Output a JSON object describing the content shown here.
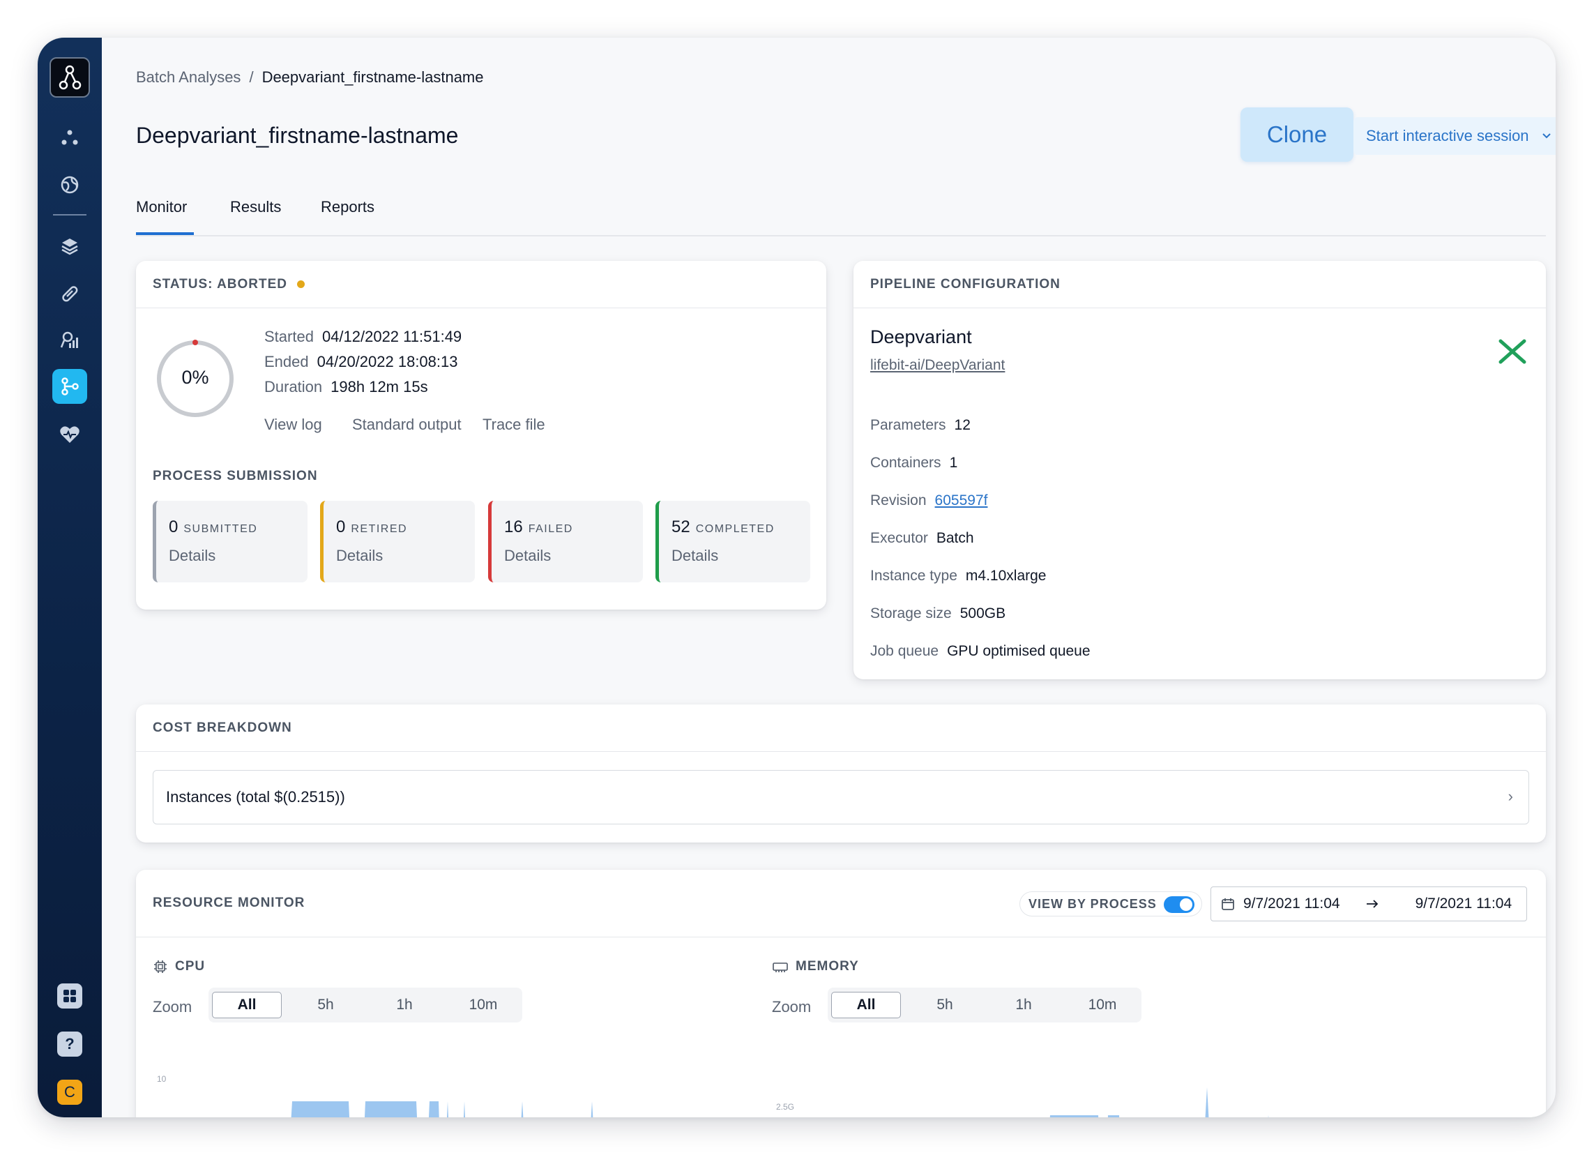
{
  "sidebar": {
    "items": [
      "nodes-icon",
      "globe-icon",
      "layers-icon",
      "link-icon",
      "analytics-icon",
      "workflow-icon",
      "heart-icon"
    ],
    "bottom": [
      "apps-icon",
      "help-icon",
      "user-avatar"
    ],
    "avatar_letter": "C"
  },
  "breadcrumb": {
    "parent": "Batch Analyses",
    "separator": "/",
    "current": "Deepvariant_firstname-lastname"
  },
  "page": {
    "title": "Deepvariant_firstname-lastname",
    "clone_label": "Clone",
    "session_label": "Start interactive session"
  },
  "tabs": [
    {
      "label": "Monitor"
    },
    {
      "label": "Results"
    },
    {
      "label": "Reports"
    }
  ],
  "status": {
    "header": "STATUS: ABORTED",
    "progress_label": "0%",
    "progress_value": 0,
    "started_label": "Started",
    "started": "04/12/2022 11:51:49",
    "ended_label": "Ended",
    "ended": "04/20/2022 18:08:13",
    "duration_label": "Duration",
    "duration": "198h 12m 15s",
    "links": {
      "view_log": "View log",
      "stdout": "Standard output",
      "trace": "Trace file"
    },
    "colors": {
      "aborted": "#e3a81a"
    }
  },
  "process_submission": {
    "title": "PROCESS SUBMISSION",
    "stats": [
      {
        "count": "0",
        "label": "SUBMITTED",
        "details": "Details",
        "color": "#9ca3af"
      },
      {
        "count": "0",
        "label": "RETIRED",
        "details": "Details",
        "color": "#e3a81a"
      },
      {
        "count": "16",
        "label": "FAILED",
        "details": "Details",
        "color": "#d63a3a"
      },
      {
        "count": "52",
        "label": "COMPLETED",
        "details": "Details",
        "color": "#1f9d4a"
      }
    ]
  },
  "pipeline": {
    "header": "PIPELINE CONFIGURATION",
    "name": "Deepvariant",
    "repo": "lifebit-ai/DeepVariant",
    "params_label": "Parameters",
    "params": "12",
    "containers_label": "Containers",
    "containers": "1",
    "revision_label": "Revision",
    "revision": "605597f",
    "executor_label": "Executor",
    "executor": "Batch",
    "instance_label": "Instance type",
    "instance": "m4.10xlarge",
    "storage_label": "Storage size",
    "storage": "500GB",
    "queue_label": "Job queue",
    "queue": "GPU optimised queue",
    "logo_color": "#20a05a"
  },
  "cost": {
    "header": "COST BREAKDOWN",
    "instances": "Instances (total $(0.2515))"
  },
  "resource": {
    "header": "RESOURCE MONITOR",
    "view_by_process": "VIEW BY PROCESS",
    "view_by_process_on": true,
    "date_from": "9/7/2021 11:04",
    "date_to": "9/7/2021 11:04",
    "cpu": {
      "label": "CPU",
      "zoom_label": "Zoom",
      "zoom_options": [
        "All",
        "5h",
        "1h",
        "10m"
      ],
      "selected": "All",
      "y_tick": "10"
    },
    "memory": {
      "label": "MEMORY",
      "zoom_label": "Zoom",
      "zoom_options": [
        "All",
        "5h",
        "1h",
        "10m"
      ],
      "selected": "All",
      "y_tick": "2.5G"
    },
    "chart_color": "#9cc6f0"
  }
}
